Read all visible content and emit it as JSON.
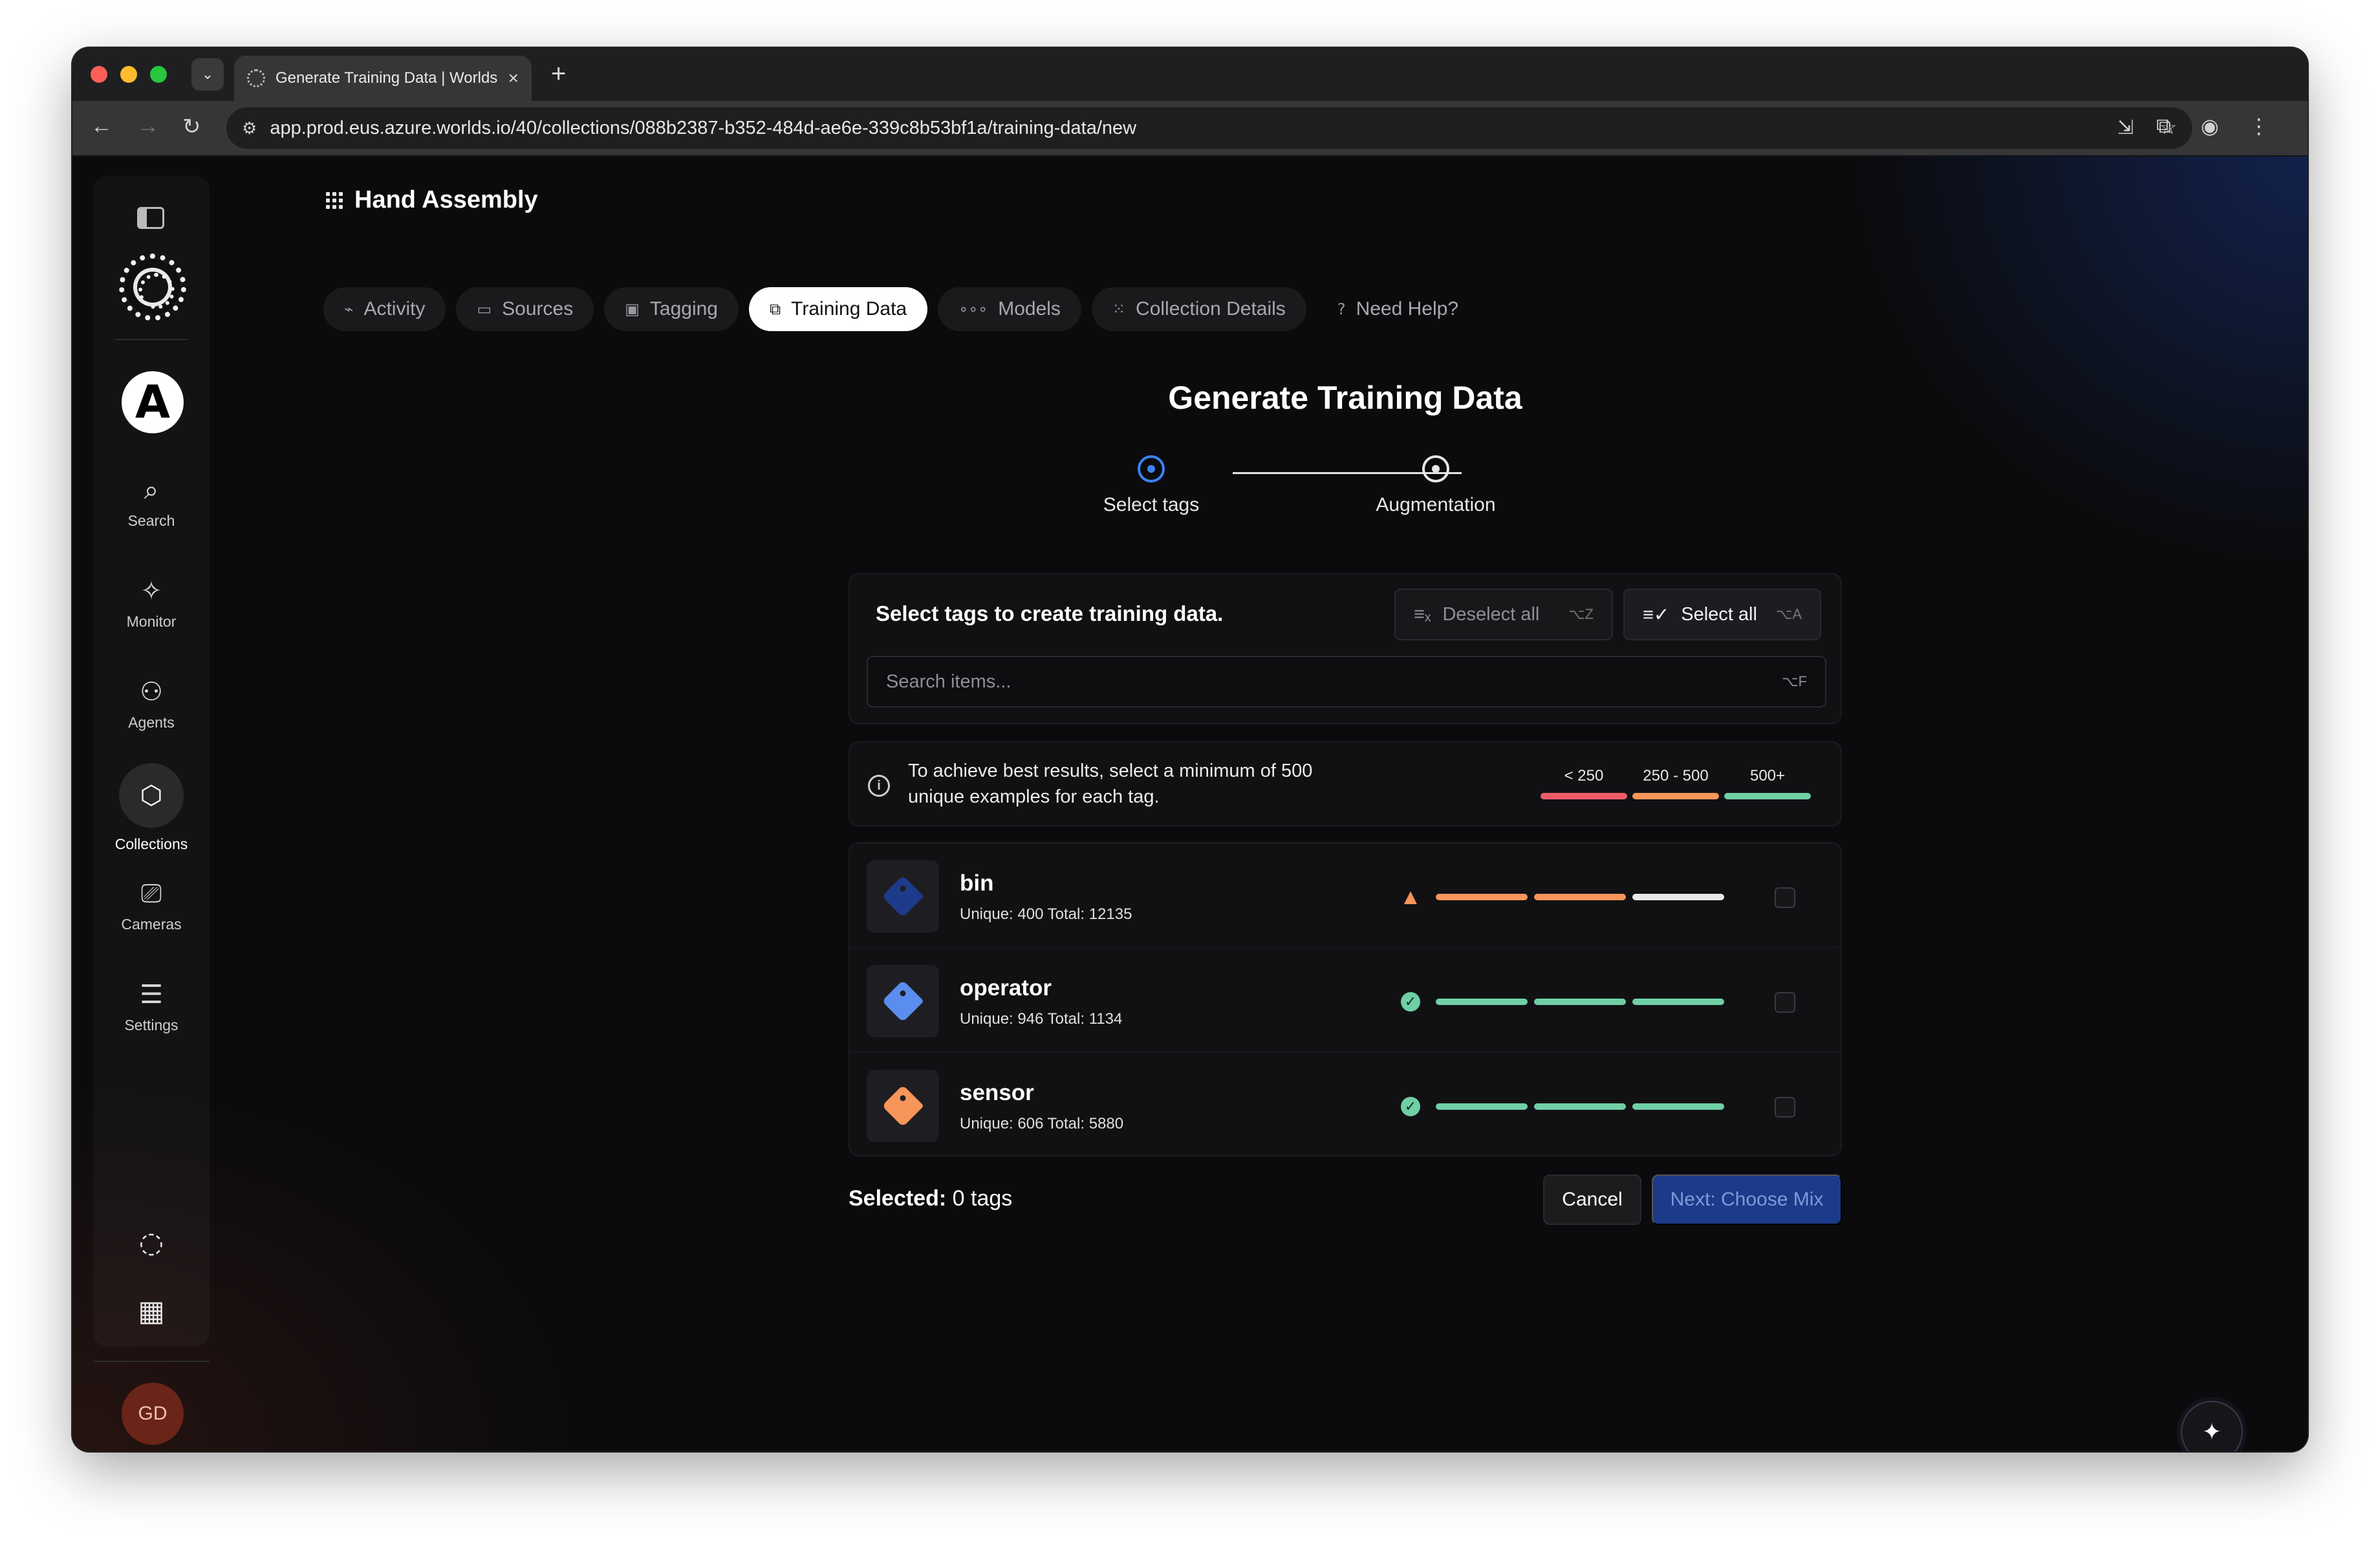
{
  "browser": {
    "tab_title": "Generate Training Data | Worlds",
    "url": "app.prod.eus.azure.worlds.io/40/collections/088b2387-b352-484d-ae6e-339c8b53bf1a/training-data/new"
  },
  "sidebar": {
    "items": [
      {
        "label": "Search",
        "icon": "search-icon"
      },
      {
        "label": "Monitor",
        "icon": "monitor-icon"
      },
      {
        "label": "Agents",
        "icon": "robot-icon"
      },
      {
        "label": "Collections",
        "icon": "collections-icon",
        "active": true
      },
      {
        "label": "Cameras",
        "icon": "camera-icon"
      },
      {
        "label": "Settings",
        "icon": "sliders-icon"
      }
    ],
    "avatar_initials": "GD"
  },
  "header": {
    "title": "Hand Assembly"
  },
  "tabs": [
    {
      "label": "Activity",
      "icon": "activity-icon"
    },
    {
      "label": "Sources",
      "icon": "sources-icon"
    },
    {
      "label": "Tagging",
      "icon": "tagging-icon"
    },
    {
      "label": "Training Data",
      "icon": "training-data-icon",
      "active": true
    },
    {
      "label": "Models",
      "icon": "models-icon"
    },
    {
      "label": "Collection Details",
      "icon": "grid-icon"
    },
    {
      "label": "Need Help?",
      "icon": "help-icon"
    }
  ],
  "page": {
    "title": "Generate Training Data",
    "steps": [
      {
        "label": "Select tags",
        "active": true
      },
      {
        "label": "Augmentation",
        "active": false
      }
    ]
  },
  "select_card": {
    "title": "Select tags to create training data.",
    "deselect_label": "Deselect all",
    "deselect_shortcut": "⌥Z",
    "select_label": "Select all",
    "select_shortcut": "⌥A",
    "search_placeholder": "Search items...",
    "search_shortcut": "⌥F"
  },
  "info": {
    "text": "To achieve best results, select a minimum of 500 unique examples for each tag.",
    "legend": [
      {
        "label": "< 250",
        "color": "#ee5d67"
      },
      {
        "label": "250 - 500",
        "color": "#f7955a"
      },
      {
        "label": "500+",
        "color": "#6fcfa5"
      }
    ]
  },
  "tags": [
    {
      "name": "bin",
      "stats": "Unique: 400 Total: 12135",
      "color": "#1e3a8a",
      "status": "warning",
      "segments": [
        "#f7955a",
        "#f7955a",
        "#e8e8e8"
      ],
      "selected": false
    },
    {
      "name": "operator",
      "stats": "Unique: 946 Total: 1134",
      "color": "#5b8def",
      "status": "ok",
      "segments": [
        "#6fcfa5",
        "#6fcfa5",
        "#6fcfa5"
      ],
      "selected": false
    },
    {
      "name": "sensor",
      "stats": "Unique: 606 Total: 5880",
      "color": "#f7955a",
      "status": "ok",
      "segments": [
        "#6fcfa5",
        "#6fcfa5",
        "#6fcfa5"
      ],
      "selected": false
    }
  ],
  "footer": {
    "selected_label": "Selected:",
    "selected_value": "0 tags",
    "cancel_label": "Cancel",
    "next_label": "Next: Choose Mix"
  }
}
